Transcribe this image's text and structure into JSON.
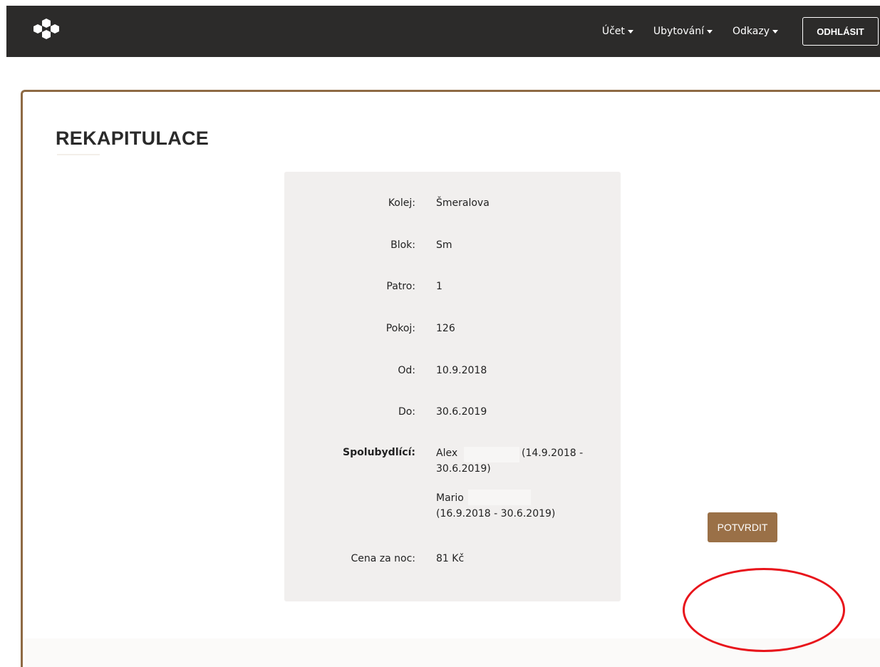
{
  "nav": {
    "items": [
      {
        "label": "Účet"
      },
      {
        "label": "Ubytování"
      },
      {
        "label": "Odkazy"
      }
    ],
    "logout_label": "ODHLÁSIT"
  },
  "page": {
    "title": "REKAPITULACE"
  },
  "summary": {
    "rows": [
      {
        "label": "Kolej:",
        "value": "Šmeralova"
      },
      {
        "label": "Blok:",
        "value": "Sm"
      },
      {
        "label": "Patro:",
        "value": "1"
      },
      {
        "label": "Pokoj:",
        "value": "126"
      },
      {
        "label": "Od:",
        "value": "10.9.2018"
      },
      {
        "label": "Do:",
        "value": "30.6.2019"
      }
    ],
    "roommates_label": "Spolubydlící:",
    "roommates": [
      {
        "line1": "Alex",
        "line1_dates": "(14.9.2018 -",
        "line2": "30.6.2019)"
      },
      {
        "line1": "Mario",
        "line2": "(16.9.2018 - 30.6.2019)"
      }
    ],
    "price_label": "Cena za noc:",
    "price_value": "81 Kč"
  },
  "confirm_label": "POTVRDIT",
  "colors": {
    "navbar": "#2c2b2a",
    "accent": "#9a7047",
    "card": "#f1efee",
    "highlight": "#e8141b"
  }
}
